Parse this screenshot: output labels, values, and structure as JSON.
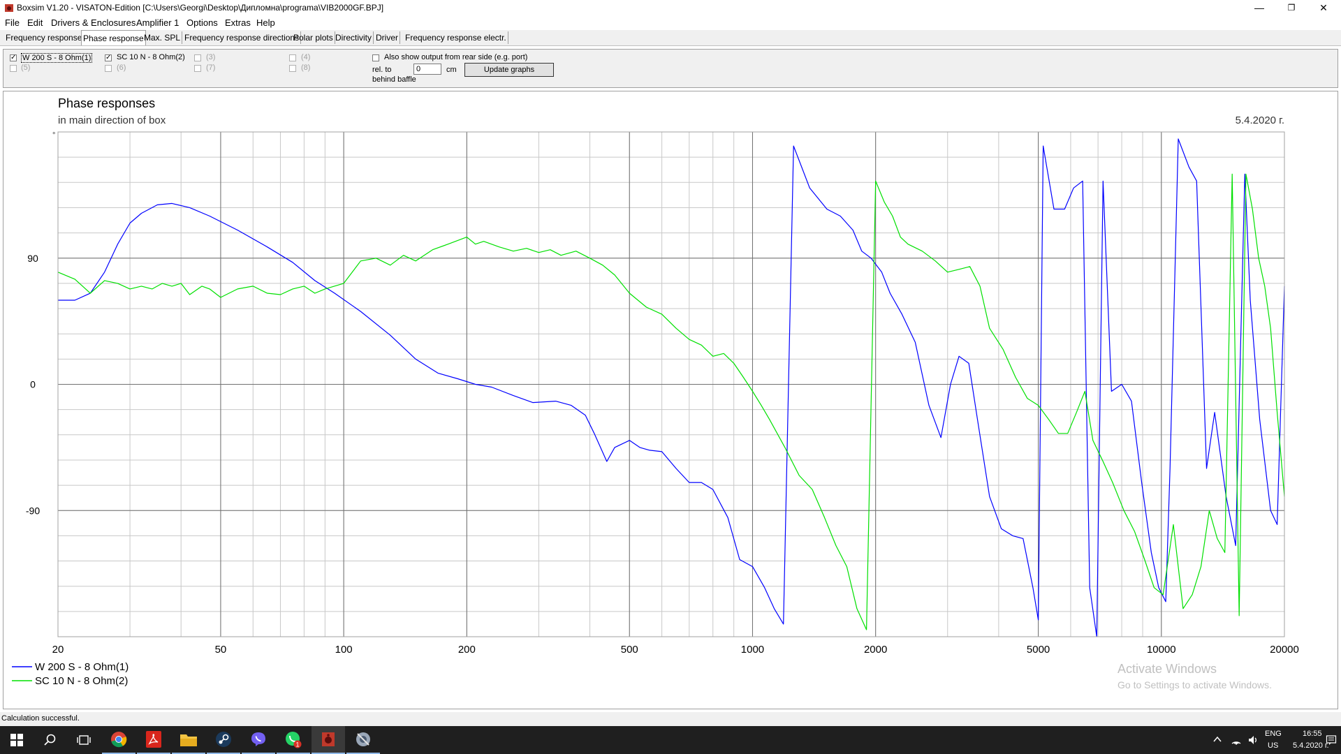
{
  "window": {
    "title": "Boxsim V1.20 - VISATON-Edition [C:\\Users\\Georgi\\Desktop\\Дипломна\\programa\\VIB2000GF.BPJ]",
    "minimize": "—",
    "maximize": "❐",
    "close": "✕"
  },
  "menu": {
    "items": [
      {
        "label": "File"
      },
      {
        "label": "Edit"
      },
      {
        "label": "Drivers & Enclosures"
      },
      {
        "label": "Amplifier 1"
      },
      {
        "label": "Options"
      },
      {
        "label": "Extras"
      },
      {
        "label": "Help"
      }
    ]
  },
  "tabs": [
    {
      "label": "Frequency response."
    },
    {
      "label": "Phase response",
      "active": true
    },
    {
      "label": "Max. SPL"
    },
    {
      "label": "Frequency response directions"
    },
    {
      "label": "Polar plots"
    },
    {
      "label": "Directivity"
    },
    {
      "label": "Driver"
    },
    {
      "label": "Frequency response electr."
    }
  ],
  "controls": {
    "drivers": [
      {
        "label": "W 200 S - 8 Ohm(1)",
        "checked": true,
        "enabled": true
      },
      {
        "label": "SC 10 N - 8 Ohm(2)",
        "checked": true,
        "enabled": true
      },
      {
        "label": "(3)",
        "checked": false,
        "enabled": false
      },
      {
        "label": "(4)",
        "checked": false,
        "enabled": false
      },
      {
        "label": "(5)",
        "checked": false,
        "enabled": false
      },
      {
        "label": "(6)",
        "checked": false,
        "enabled": false
      },
      {
        "label": "(7)",
        "checked": false,
        "enabled": false
      },
      {
        "label": "(8)",
        "checked": false,
        "enabled": false
      }
    ],
    "rear_output_label": "Also show output from rear side (e.g. port)",
    "rel_to_label": "rel. to",
    "behind_baffle_label": "behind baffle",
    "distance_value": "0",
    "unit_label": "cm",
    "update_button": "Update graphs"
  },
  "chart_data": {
    "type": "line",
    "title": "Phase responses",
    "subtitle": "in main direction of box",
    "date": "5.4.2020 г.",
    "y_unit": "°",
    "x_scale": "log",
    "xlim": [
      20,
      20000
    ],
    "ylim": [
      -180,
      180
    ],
    "x_ticks": [
      20,
      50,
      100,
      200,
      500,
      1000,
      2000,
      5000,
      10000,
      20000
    ],
    "x_tick_labels": [
      "20",
      "50",
      "100",
      "200",
      "500",
      "1000",
      "2000",
      "5000",
      "10000",
      "20000"
    ],
    "y_ticks": [
      90,
      0,
      -90
    ],
    "y_tick_labels": [
      "90",
      "0",
      "-90"
    ],
    "grid": true,
    "legend_position": "bottom-left",
    "series": [
      {
        "name": "W 200 S - 8 Ohm(1)",
        "color": "#0000ff",
        "points": [
          [
            20,
            60
          ],
          [
            22,
            60
          ],
          [
            24,
            65
          ],
          [
            26,
            80
          ],
          [
            28,
            100
          ],
          [
            30,
            115
          ],
          [
            32,
            122
          ],
          [
            35,
            128
          ],
          [
            38,
            129
          ],
          [
            42,
            126
          ],
          [
            47,
            120
          ],
          [
            55,
            110
          ],
          [
            65,
            98
          ],
          [
            75,
            87
          ],
          [
            85,
            74
          ],
          [
            95,
            65
          ],
          [
            110,
            52
          ],
          [
            130,
            35
          ],
          [
            150,
            18
          ],
          [
            170,
            8
          ],
          [
            190,
            4
          ],
          [
            210,
            0
          ],
          [
            230,
            -2
          ],
          [
            260,
            -8
          ],
          [
            290,
            -13
          ],
          [
            330,
            -12
          ],
          [
            360,
            -15
          ],
          [
            390,
            -22
          ],
          [
            410,
            -35
          ],
          [
            440,
            -55
          ],
          [
            460,
            -45
          ],
          [
            500,
            -40
          ],
          [
            530,
            -45
          ],
          [
            560,
            -47
          ],
          [
            600,
            -48
          ],
          [
            650,
            -60
          ],
          [
            700,
            -70
          ],
          [
            750,
            -70
          ],
          [
            800,
            -75
          ],
          [
            870,
            -95
          ],
          [
            930,
            -125
          ],
          [
            1000,
            -130
          ],
          [
            1070,
            -145
          ],
          [
            1130,
            -160
          ],
          [
            1190,
            -171
          ],
          [
            1260,
            170
          ],
          [
            1380,
            140
          ],
          [
            1520,
            125
          ],
          [
            1640,
            120
          ],
          [
            1760,
            110
          ],
          [
            1850,
            95
          ],
          [
            1950,
            90
          ],
          [
            2070,
            80
          ],
          [
            2170,
            65
          ],
          [
            2320,
            50
          ],
          [
            2500,
            30
          ],
          [
            2700,
            -15
          ],
          [
            2890,
            -38
          ],
          [
            3050,
            0
          ],
          [
            3200,
            20
          ],
          [
            3380,
            15
          ],
          [
            3550,
            -25
          ],
          [
            3800,
            -80
          ],
          [
            4060,
            -103
          ],
          [
            4330,
            -108
          ],
          [
            4590,
            -110
          ],
          [
            4850,
            -145
          ],
          [
            5000,
            -168
          ],
          [
            5140,
            170
          ],
          [
            5460,
            125
          ],
          [
            5800,
            125
          ],
          [
            6100,
            140
          ],
          [
            6420,
            145
          ],
          [
            6680,
            -145
          ],
          [
            6950,
            -180
          ],
          [
            7200,
            145
          ],
          [
            7550,
            -5
          ],
          [
            8000,
            0
          ],
          [
            8450,
            -12
          ],
          [
            8950,
            -70
          ],
          [
            9450,
            -120
          ],
          [
            9850,
            -145
          ],
          [
            10250,
            -155
          ],
          [
            10500,
            -60
          ],
          [
            11000,
            175
          ],
          [
            11680,
            155
          ],
          [
            12200,
            145
          ],
          [
            12900,
            -60
          ],
          [
            13500,
            -20
          ],
          [
            14400,
            -80
          ],
          [
            15200,
            -115
          ],
          [
            16000,
            150
          ],
          [
            16500,
            60
          ],
          [
            17400,
            -25
          ],
          [
            18500,
            -90
          ],
          [
            19200,
            -100
          ],
          [
            20000,
            70
          ]
        ]
      },
      {
        "name": "SC 10 N - 8 Ohm(2)",
        "color": "#00e000",
        "points": [
          [
            20,
            80
          ],
          [
            22,
            75
          ],
          [
            24,
            65
          ],
          [
            26,
            74
          ],
          [
            28,
            72
          ],
          [
            30,
            68
          ],
          [
            32,
            70
          ],
          [
            34,
            68
          ],
          [
            36,
            72
          ],
          [
            38,
            70
          ],
          [
            40,
            72
          ],
          [
            42,
            64
          ],
          [
            45,
            70
          ],
          [
            47,
            68
          ],
          [
            50,
            62
          ],
          [
            55,
            68
          ],
          [
            60,
            70
          ],
          [
            65,
            65
          ],
          [
            70,
            64
          ],
          [
            75,
            68
          ],
          [
            80,
            70
          ],
          [
            85,
            65
          ],
          [
            90,
            68
          ],
          [
            100,
            72
          ],
          [
            110,
            88
          ],
          [
            120,
            90
          ],
          [
            130,
            85
          ],
          [
            140,
            92
          ],
          [
            150,
            88
          ],
          [
            165,
            96
          ],
          [
            180,
            100
          ],
          [
            200,
            105
          ],
          [
            210,
            100
          ],
          [
            220,
            102
          ],
          [
            240,
            98
          ],
          [
            260,
            95
          ],
          [
            280,
            97
          ],
          [
            300,
            94
          ],
          [
            320,
            96
          ],
          [
            340,
            92
          ],
          [
            370,
            95
          ],
          [
            400,
            90
          ],
          [
            430,
            85
          ],
          [
            460,
            78
          ],
          [
            500,
            65
          ],
          [
            550,
            55
          ],
          [
            600,
            50
          ],
          [
            650,
            40
          ],
          [
            700,
            32
          ],
          [
            750,
            28
          ],
          [
            800,
            20
          ],
          [
            850,
            22
          ],
          [
            900,
            15
          ],
          [
            950,
            5
          ],
          [
            1000,
            -5
          ],
          [
            1050,
            -15
          ],
          [
            1100,
            -25
          ],
          [
            1200,
            -45
          ],
          [
            1300,
            -65
          ],
          [
            1400,
            -75
          ],
          [
            1500,
            -95
          ],
          [
            1600,
            -115
          ],
          [
            1700,
            -130
          ],
          [
            1800,
            -160
          ],
          [
            1900,
            -175
          ],
          [
            2000,
            145
          ],
          [
            2100,
            130
          ],
          [
            2200,
            120
          ],
          [
            2300,
            105
          ],
          [
            2400,
            100
          ],
          [
            2600,
            95
          ],
          [
            2800,
            88
          ],
          [
            3000,
            80
          ],
          [
            3200,
            82
          ],
          [
            3400,
            84
          ],
          [
            3600,
            70
          ],
          [
            3800,
            40
          ],
          [
            4100,
            25
          ],
          [
            4400,
            5
          ],
          [
            4700,
            -10
          ],
          [
            5000,
            -15
          ],
          [
            5300,
            -25
          ],
          [
            5600,
            -35
          ],
          [
            5900,
            -35
          ],
          [
            6200,
            -20
          ],
          [
            6500,
            -5
          ],
          [
            6800,
            -40
          ],
          [
            7200,
            -55
          ],
          [
            7600,
            -70
          ],
          [
            8100,
            -90
          ],
          [
            8600,
            -105
          ],
          [
            9100,
            -125
          ],
          [
            9600,
            -145
          ],
          [
            10100,
            -150
          ],
          [
            10700,
            -100
          ],
          [
            11300,
            -160
          ],
          [
            11900,
            -150
          ],
          [
            12500,
            -130
          ],
          [
            13100,
            -90
          ],
          [
            13700,
            -110
          ],
          [
            14300,
            -120
          ],
          [
            14900,
            150
          ],
          [
            15500,
            -165
          ],
          [
            16100,
            150
          ],
          [
            16700,
            125
          ],
          [
            17300,
            90
          ],
          [
            17900,
            70
          ],
          [
            18500,
            40
          ],
          [
            19200,
            -20
          ],
          [
            20000,
            -80
          ]
        ]
      }
    ]
  },
  "watermark": {
    "line1": "Activate Windows",
    "line2": "Go to Settings to activate Windows."
  },
  "status": {
    "text": "Calculation successful."
  },
  "taskbar": {
    "tray": {
      "lang": "ENG",
      "layout": "US",
      "time": "16:55",
      "date": "5.4.2020 г.",
      "notification_count": "1"
    }
  }
}
